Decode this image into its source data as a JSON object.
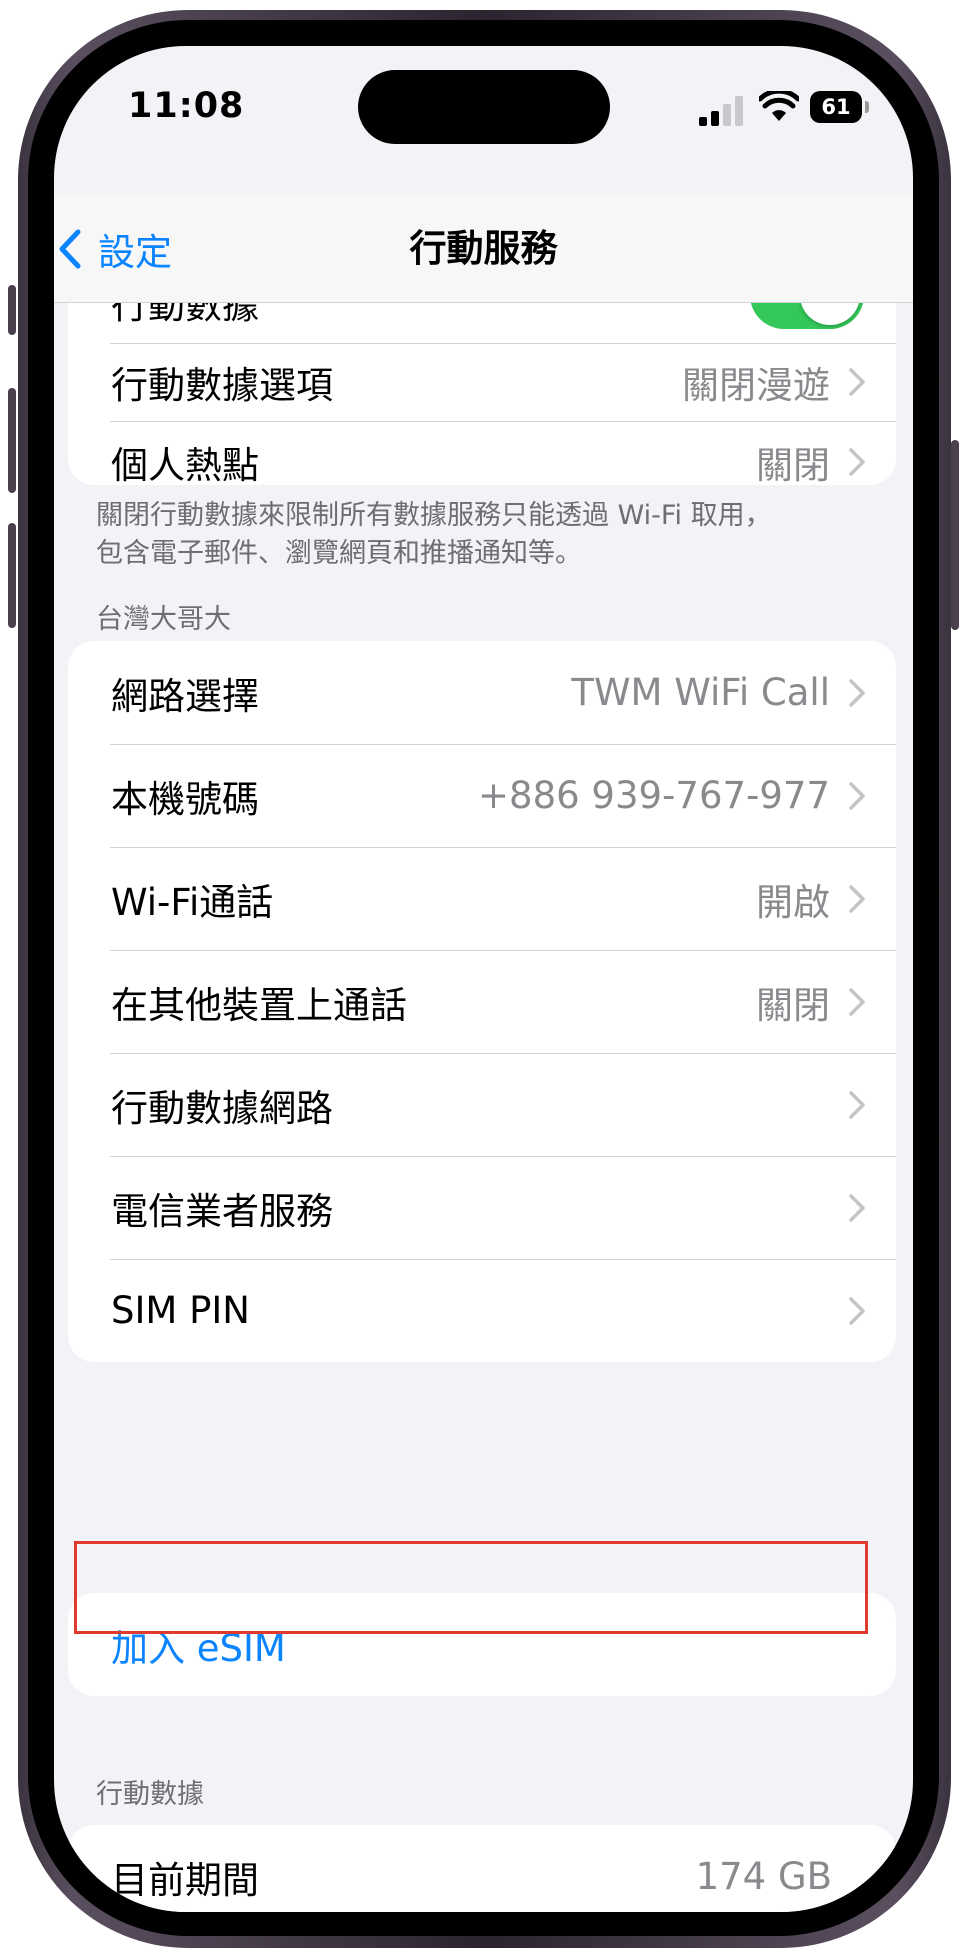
{
  "status_bar": {
    "time": "11:08",
    "battery": "61"
  },
  "nav": {
    "back_label": "設定",
    "title": "行動服務"
  },
  "group1": {
    "rows": [
      {
        "label": "行動數據",
        "toggle_on": true
      },
      {
        "label": "行動數據選項",
        "value": "關閉漫遊"
      },
      {
        "label": "個人熱點",
        "value": "關閉"
      }
    ],
    "footnote_line1": "關閉行動數據來限制所有數據服務只能透過 Wi-Fi 取用，",
    "footnote_line2": "包含電子郵件、瀏覽網頁和推播通知等。"
  },
  "carrier_section": {
    "header": "台灣大哥大",
    "rows": [
      {
        "label": "網路選擇",
        "value": "TWM WiFi Call"
      },
      {
        "label": "本機號碼",
        "value": "+886 939-767-977"
      },
      {
        "label": "Wi-Fi通話",
        "value": "開啟"
      },
      {
        "label": "在其他裝置上通話",
        "value": "關閉"
      },
      {
        "label": "行動數據網路",
        "value": ""
      },
      {
        "label": "電信業者服務",
        "value": ""
      },
      {
        "label": "SIM PIN",
        "value": ""
      }
    ]
  },
  "esim": {
    "label": "加入 eSIM"
  },
  "data_section": {
    "header": "行動數據",
    "rows": [
      {
        "label": "目前期間",
        "value": "174 GB"
      }
    ]
  },
  "colors": {
    "accent": "#0a84ff",
    "toggle_on": "#34c759",
    "highlight": "#e03a2f"
  }
}
